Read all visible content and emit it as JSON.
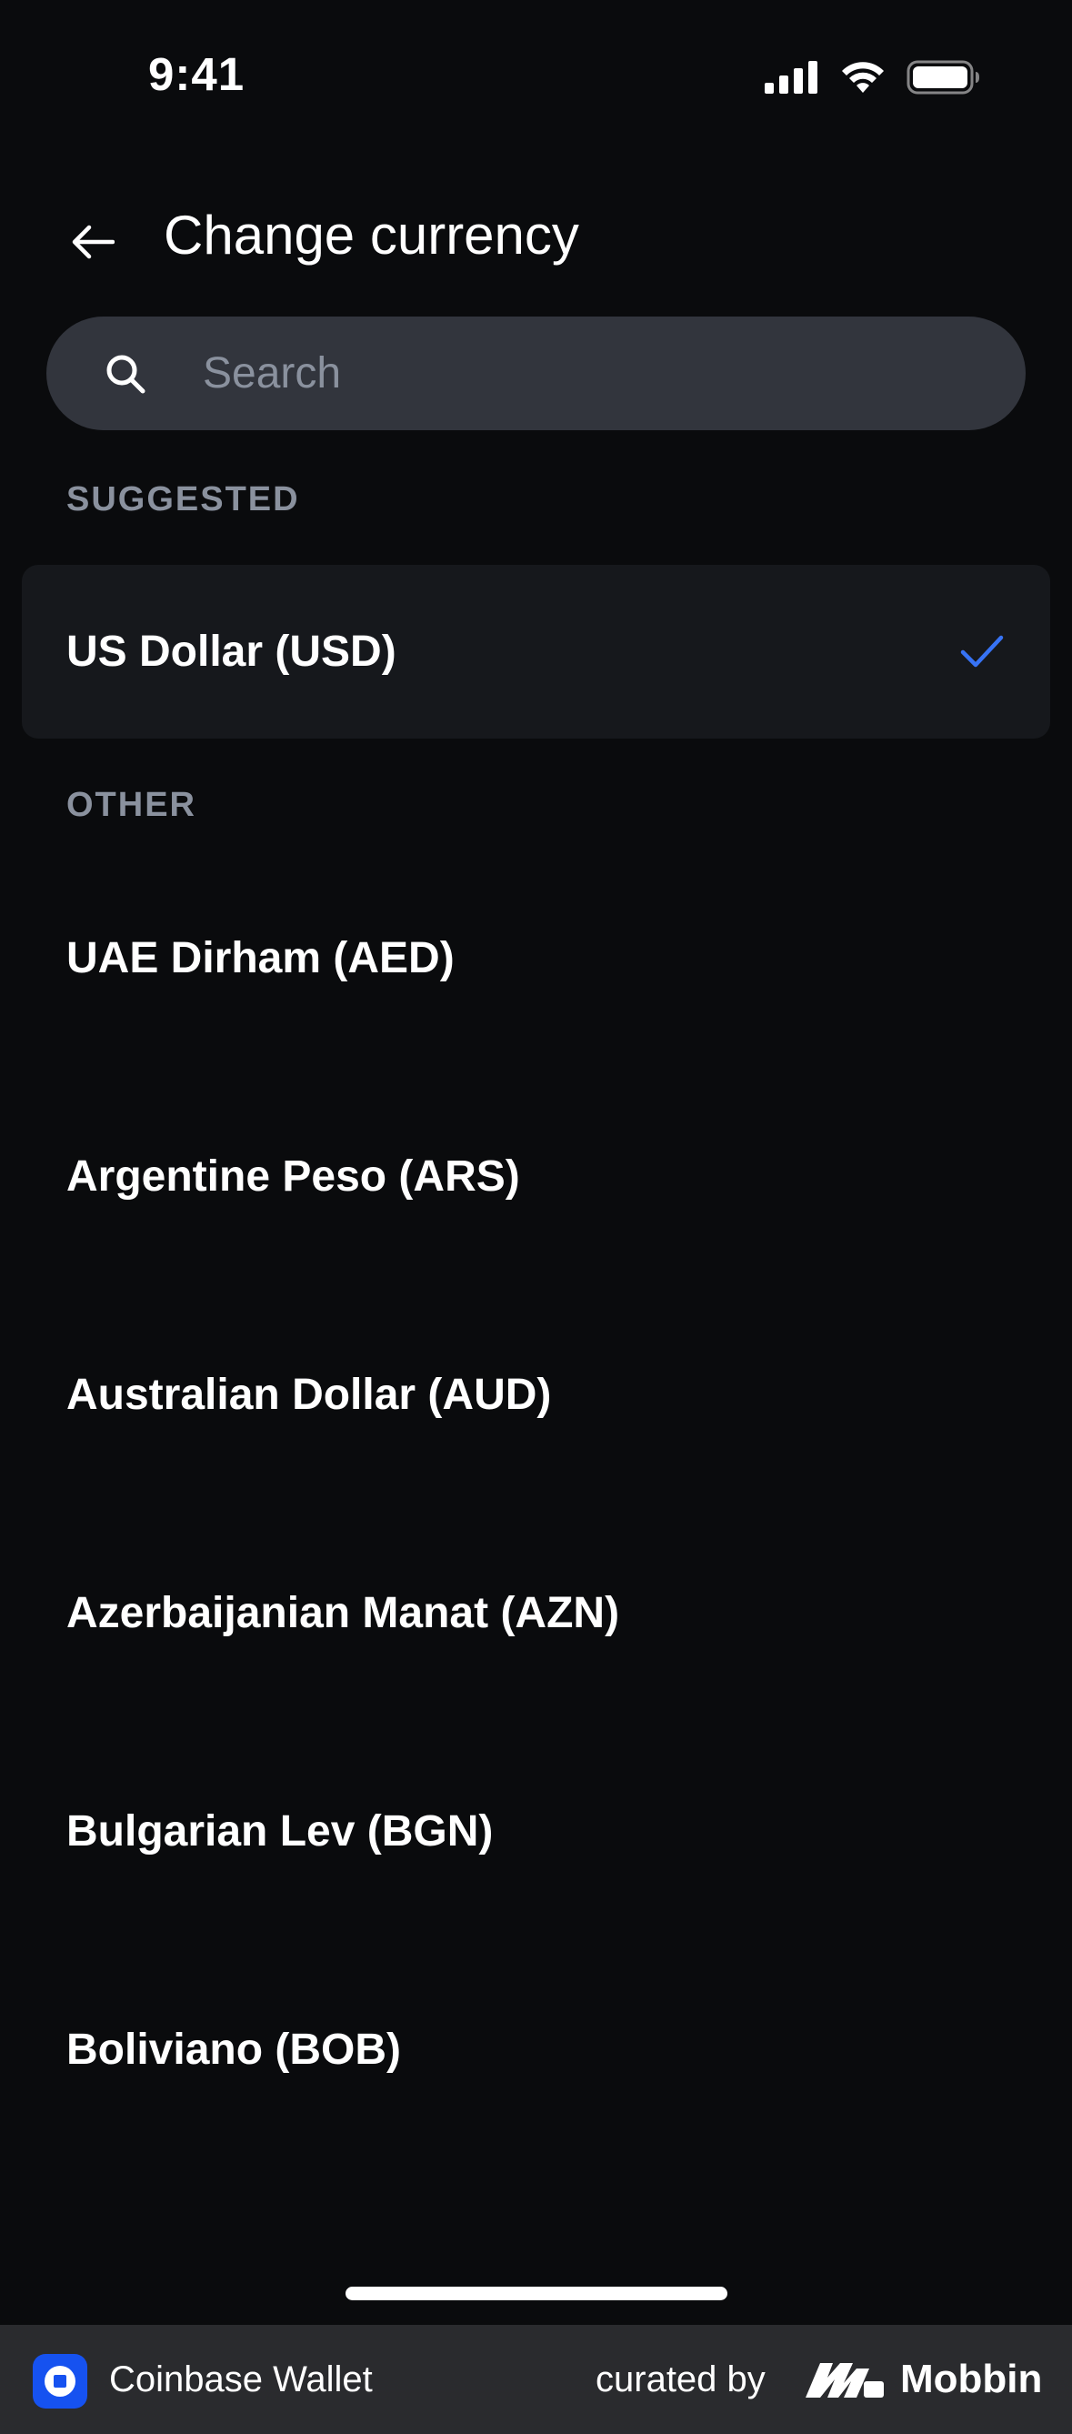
{
  "status_bar": {
    "time": "9:41",
    "icons": [
      "cellular-signal-icon",
      "wifi-icon",
      "battery-icon"
    ]
  },
  "header": {
    "back_icon": "arrow-left-icon",
    "title": "Change currency"
  },
  "search": {
    "placeholder": "Search",
    "value": "",
    "icon": "search-icon"
  },
  "sections": {
    "suggested_label": "SUGGESTED",
    "other_label": "OTHER"
  },
  "suggested": [
    {
      "label": "US Dollar (USD)",
      "selected": true
    }
  ],
  "other": [
    {
      "label": "UAE Dirham (AED)"
    },
    {
      "label": "Argentine Peso (ARS)"
    },
    {
      "label": "Australian Dollar (AUD)"
    },
    {
      "label": "Azerbaijanian Manat (AZN)"
    },
    {
      "label": "Bulgarian Lev (BGN)"
    },
    {
      "label": "Boliviano (BOB)"
    }
  ],
  "footer": {
    "app_name": "Coinbase Wallet",
    "curated_by": "curated by",
    "brand": "Mobbin"
  },
  "colors": {
    "background": "#0a0b0d",
    "search_background": "#32353d",
    "selected_row_background": "#16181c",
    "section_label": "#8a919e",
    "accent_check": "#3773f5",
    "footer_background": "#2a2b2e",
    "coinbase_blue": "#1652f0"
  }
}
